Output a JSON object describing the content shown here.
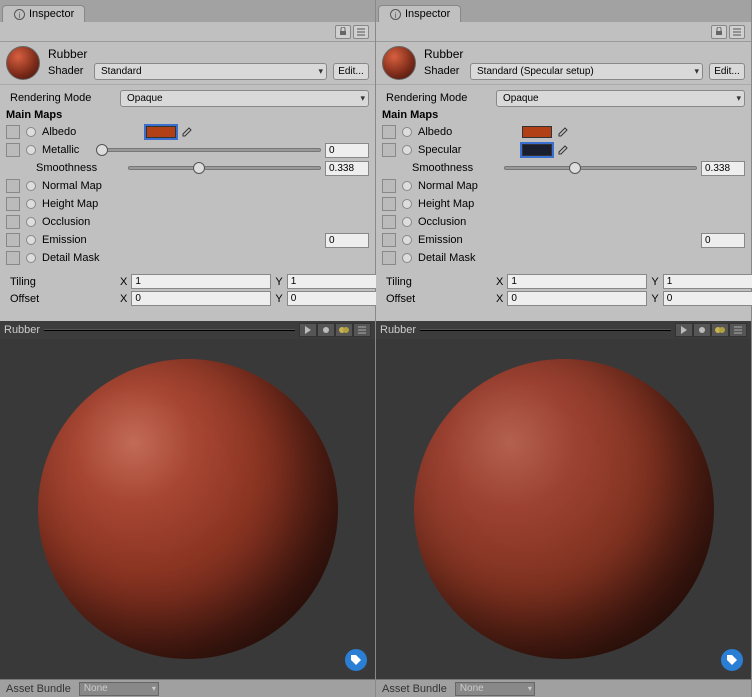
{
  "panels": [
    {
      "tab": "Inspector",
      "material_name": "Rubber",
      "shader_label": "Shader",
      "shader_value": "Standard",
      "edit_label": "Edit...",
      "rendering_mode_label": "Rendering Mode",
      "rendering_mode_value": "Opaque",
      "main_maps_label": "Main Maps",
      "rows": {
        "albedo": {
          "label": "Albedo",
          "color": "#b24016",
          "selected": true
        },
        "second": {
          "label": "Metallic",
          "has_color": false,
          "slider_pos": 0,
          "value": "0"
        },
        "smoothness": {
          "label": "Smoothness",
          "slider_pos": 33.8,
          "value": "0.338"
        },
        "normal": "Normal Map",
        "height": "Height Map",
        "occlusion": "Occlusion",
        "emission": {
          "label": "Emission",
          "value": "0"
        },
        "detail": "Detail Mask"
      },
      "tiling": {
        "label": "Tiling",
        "x": "1",
        "y": "1"
      },
      "offset": {
        "label": "Offset",
        "x": "0",
        "y": "0"
      },
      "preview_title": "Rubber",
      "asset_bundle_label": "Asset Bundle",
      "asset_bundle_value": "None"
    },
    {
      "tab": "Inspector",
      "material_name": "Rubber",
      "shader_label": "Shader",
      "shader_value": "Standard (Specular setup)",
      "edit_label": "Edit...",
      "rendering_mode_label": "Rendering Mode",
      "rendering_mode_value": "Opaque",
      "main_maps_label": "Main Maps",
      "rows": {
        "albedo": {
          "label": "Albedo",
          "color": "#b24016",
          "selected": false
        },
        "second": {
          "label": "Specular",
          "has_color": true,
          "color": "#1a1f2f",
          "selected": true
        },
        "smoothness": {
          "label": "Smoothness",
          "slider_pos": 33.8,
          "value": "0.338"
        },
        "normal": "Normal Map",
        "height": "Height Map",
        "occlusion": "Occlusion",
        "emission": {
          "label": "Emission",
          "value": "0"
        },
        "detail": "Detail Mask"
      },
      "tiling": {
        "label": "Tiling",
        "x": "1",
        "y": "1"
      },
      "offset": {
        "label": "Offset",
        "x": "0",
        "y": "0"
      },
      "preview_title": "Rubber",
      "asset_bundle_label": "Asset Bundle",
      "asset_bundle_value": "None"
    }
  ]
}
